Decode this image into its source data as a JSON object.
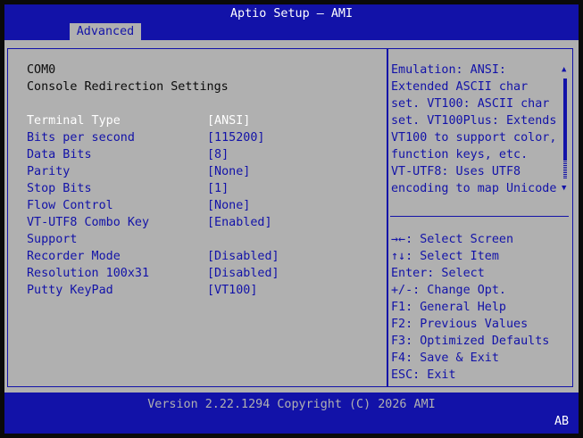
{
  "header": {
    "title": "Aptio Setup – AMI",
    "active_tab": "Advanced"
  },
  "settings": {
    "port": "COM0",
    "heading": "Console Redirection Settings",
    "items": [
      {
        "label": "Terminal Type",
        "value": "[ANSI]",
        "selected": true
      },
      {
        "label": "Bits per second",
        "value": "[115200]"
      },
      {
        "label": "Data Bits",
        "value": "[8]"
      },
      {
        "label": "Parity",
        "value": "[None]"
      },
      {
        "label": "Stop Bits",
        "value": "[1]"
      },
      {
        "label": "Flow Control",
        "value": "[None]"
      },
      {
        "label": "VT-UTF8 Combo Key",
        "label2": "Support",
        "value": "[Enabled]"
      },
      {
        "label": "Recorder Mode",
        "value": "[Disabled]"
      },
      {
        "label": "Resolution 100x31",
        "value": "[Disabled]"
      },
      {
        "label": "Putty KeyPad",
        "value": "[VT100]"
      }
    ]
  },
  "help": {
    "description_lines": [
      "Emulation: ANSI:",
      "Extended ASCII char",
      "set. VT100: ASCII char",
      "set. VT100Plus: Extends",
      "VT100 to support color,",
      "function keys, etc.",
      "VT-UTF8: Uses UTF8",
      "encoding to map Unicode"
    ],
    "keys": [
      "→←: Select Screen",
      "↑↓: Select Item",
      "Enter: Select",
      "+/-: Change Opt.",
      "F1: General Help",
      "F2: Previous Values",
      "F3: Optimized Defaults",
      "F4: Save & Exit",
      "ESC: Exit"
    ]
  },
  "footer": {
    "version": "Version 2.22.1294 Copyright (C) 2026 AMI",
    "corner": "AB"
  },
  "colors": {
    "blue": "#1212a8",
    "gray": "#b0b0b0",
    "white": "#ffffff"
  }
}
